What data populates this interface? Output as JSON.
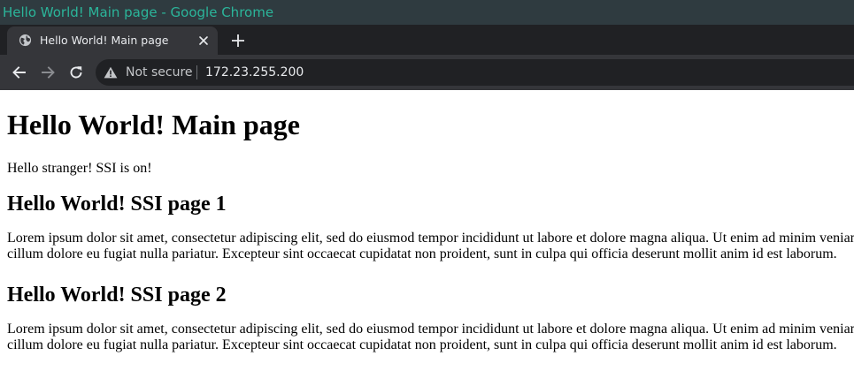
{
  "window": {
    "title": "Hello World! Main page - Google Chrome"
  },
  "tabs": [
    {
      "title": "Hello World! Main page",
      "favicon": "globe-icon",
      "active": true
    }
  ],
  "toolbar": {
    "security_label": "Not secure",
    "security_icon": "warning-triangle-icon",
    "url": "172.23.255.200",
    "back_icon": "arrow-left-icon",
    "forward_icon": "arrow-right-icon",
    "reload_icon": "reload-icon"
  },
  "page": {
    "heading": "Hello World! Main page",
    "intro": "Hello stranger! SSI is on!",
    "sections": [
      {
        "heading": "Hello World! SSI page 1",
        "lines": [
          "Lorem ipsum dolor sit amet, consectetur adipiscing elit, sed do eiusmod tempor incididunt ut labore et dolore magna aliqua. Ut enim ad minim veniam",
          "cillum dolore eu fugiat nulla pariatur. Excepteur sint occaecat cupidatat non proident, sunt in culpa qui officia deserunt mollit anim id est laborum."
        ]
      },
      {
        "heading": "Hello World! SSI page 2",
        "lines": [
          "Lorem ipsum dolor sit amet, consectetur adipiscing elit, sed do eiusmod tempor incididunt ut labore et dolore magna aliqua. Ut enim ad minim veniam",
          "cillum dolore eu fugiat nulla pariatur. Excepteur sint occaecat cupidatat non proident, sunt in culpa qui officia deserunt mollit anim id est laborum."
        ]
      }
    ]
  },
  "colors": {
    "titlebar_bg": "#2f3b40",
    "titlebar_text": "#2bb59a",
    "tabstrip_bg": "#202124",
    "active_tab_bg": "#35363a",
    "omnibox_bg": "#202124"
  }
}
